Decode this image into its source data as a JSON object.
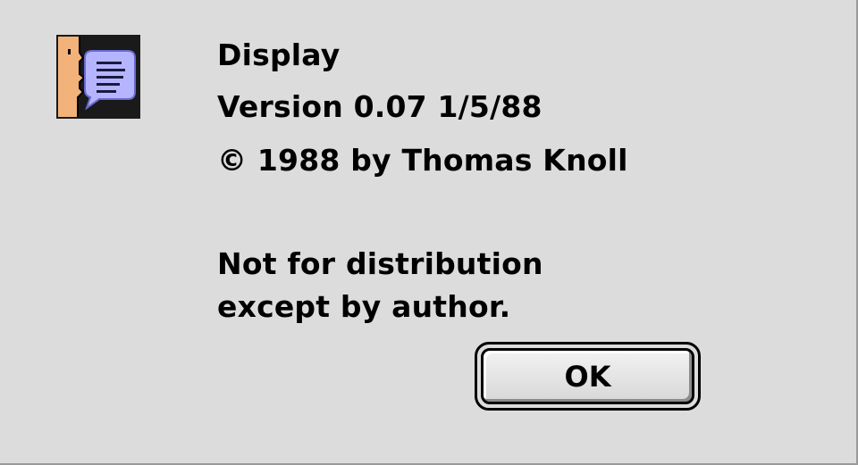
{
  "window": {
    "type": "about-dialog"
  },
  "app_icon": {
    "icon": "display-app-face-speech-bubble-icon",
    "colors": {
      "face": "#f2b27a",
      "bubble": "#b5b5ff",
      "background": "#1a1a1a"
    }
  },
  "about": {
    "app_name": "Display",
    "version": "Version 0.07 1/5/88",
    "copyright": "© 1988 by Thomas Knoll",
    "note_line1": "Not for distribution",
    "note_line2": "except by author."
  },
  "buttons": {
    "ok_label": "OK"
  }
}
